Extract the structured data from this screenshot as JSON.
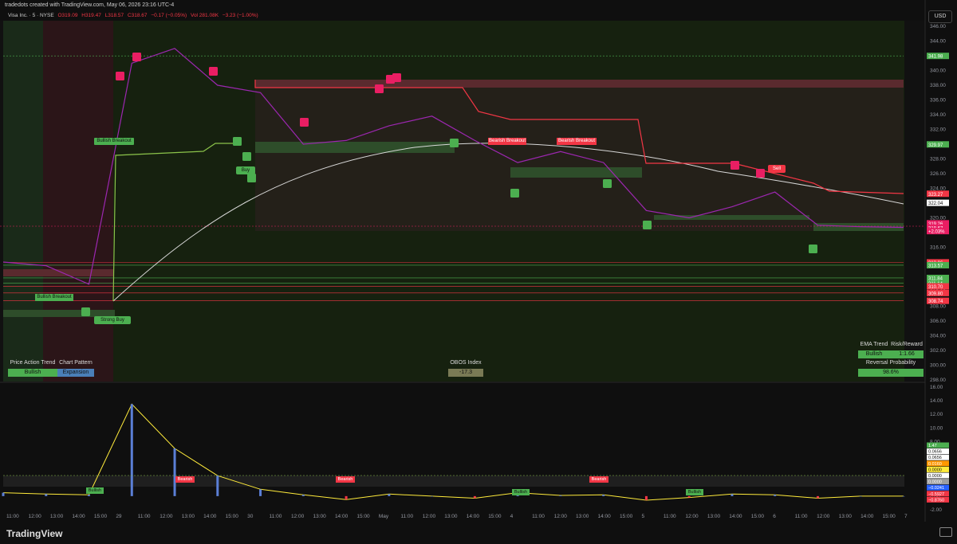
{
  "header": {
    "created_by": "tradedots created with TradingView.com, May 06, 2026 23:16 UTC-4",
    "symbol": "Visa Inc. · 5 · NYSE",
    "o": "O319.09",
    "h": "H319.47",
    "l": "L318.57",
    "c": "C318.67",
    "chg": "−0.17 (−0.05%)",
    "vol": "Vol 281.08K",
    "vol_chg": "−3.23 (−1.00%)",
    "currency": "USD"
  },
  "price_axis": [
    "346.00",
    "344.00",
    "342.00",
    "340.00",
    "338.00",
    "336.00",
    "334.00",
    "332.00",
    "330.00",
    "328.00",
    "326.00",
    "324.00",
    "322.00",
    "320.00",
    "318.00",
    "316.00",
    "314.00",
    "312.00",
    "310.00",
    "308.00",
    "306.00",
    "304.00",
    "302.00",
    "300.00",
    "298.00"
  ],
  "price_tags": [
    {
      "label": "341.98",
      "color": "#4caf50",
      "value": 341.98
    },
    {
      "label": "329.97",
      "color": "#4caf50",
      "value": 329.97
    },
    {
      "label": "323.27",
      "color": "#f23645",
      "value": 323.27
    },
    {
      "label": "322.04",
      "color": "#ffffff",
      "value": 322.04
    },
    {
      "label": "319.26",
      "color": "#e91e63",
      "value": 319.26
    },
    {
      "label": "318.67",
      "color": "#e91e63",
      "value": 318.67
    },
    {
      "label": "+2.03%",
      "color": "#e91e63",
      "value": 318.2
    },
    {
      "label": "313.96",
      "color": "#f23645",
      "value": 313.96
    },
    {
      "label": "313.57",
      "color": "#4caf50",
      "value": 313.57
    },
    {
      "label": "311.84",
      "color": "#4caf50",
      "value": 311.84
    },
    {
      "label": "311.14",
      "color": "#4caf50",
      "value": 311.14
    },
    {
      "label": "310.70",
      "color": "#f23645",
      "value": 310.7
    },
    {
      "label": "309.80",
      "color": "#f23645",
      "value": 309.8
    },
    {
      "label": "308.74",
      "color": "#f23645",
      "value": 308.74
    }
  ],
  "osc_axis": [
    "16.00",
    "14.00",
    "12.00",
    "10.00",
    "8.00",
    "6.00",
    "4.00",
    "2.00",
    "0.00",
    "-2.00"
  ],
  "osc_tags": [
    {
      "label": "1.47",
      "color": "#4caf50"
    },
    {
      "label": "0.0656",
      "color": "#ffffff"
    },
    {
      "label": "0.0656",
      "color": "#ffffff"
    },
    {
      "label": "0.0160",
      "color": "#ff9800"
    },
    {
      "label": "0.0000",
      "color": "#ffeb3b"
    },
    {
      "label": "0.0000",
      "color": "#ffffff"
    },
    {
      "label": "0.0000",
      "color": "#9e9e9e"
    },
    {
      "label": "−0.0241",
      "color": "#2962ff"
    },
    {
      "label": "−0.5927",
      "color": "#f23645"
    },
    {
      "label": "−0.8760",
      "color": "#f23645"
    }
  ],
  "time_axis": [
    "11:00",
    "12:00",
    "13:00",
    "14:00",
    "15:00",
    "29",
    "11:00",
    "12:00",
    "13:00",
    "14:00",
    "15:00",
    "30",
    "11:00",
    "12:00",
    "13:00",
    "14:00",
    "15:00",
    "May",
    "11:00",
    "12:00",
    "13:00",
    "14:00",
    "15:00",
    "4",
    "11:00",
    "12:00",
    "13:00",
    "14:00",
    "15:00",
    "5",
    "11:00",
    "12:00",
    "13:00",
    "14:00",
    "15:00",
    "6",
    "11:00",
    "12:00",
    "13:00",
    "14:00",
    "15:00",
    "7"
  ],
  "labels": {
    "bullish_breakout_1": "Bullish Breakout",
    "bullish_breakout_2": "Bullish Breakout",
    "bearish_breakout_1": "Bearish Breakout",
    "bearish_breakout_2": "Bearish Breakout",
    "buy": "Buy",
    "strong_buy": "Strong Buy",
    "sell": "Sell",
    "bearish_osc_1": "Bearish",
    "bearish_osc_2": "Bearish",
    "bearish_osc_3": "Bearish",
    "bullish_osc_1": "Bullish",
    "bullish_osc_2": "Bullish",
    "bullish_osc_3": "Bullish"
  },
  "panels": {
    "price_action_trend_title": "Price Action Trend",
    "price_action_trend_value": "Bullish",
    "chart_pattern_title": "Chart Pattern",
    "chart_pattern_value": "Expansion",
    "obos_title": "OBOS Index",
    "obos_value": "-17.3",
    "ema_trend_title": "EMA Trend",
    "ema_trend_value": "Bullish",
    "risk_reward_title": "Risk/Reward",
    "risk_reward_value": "1:1.66",
    "reversal_title": "Reversal Probability",
    "reversal_value": "98.6%"
  },
  "footer": {
    "brand": "TradingView"
  },
  "colors": {
    "bull": "#4caf50",
    "bear": "#f23645",
    "pink": "#e91e63",
    "ema": "#cfcfcf",
    "magenta": "#b21fd4",
    "teal": "#26a69a"
  },
  "chart_data": {
    "type": "line",
    "title": "",
    "x": [
      "Apr 28 11:00",
      "Apr 28 13:00",
      "Apr 28 15:00",
      "Apr 29 09:45",
      "Apr 29 10:30",
      "Apr 29 12:00",
      "Apr 29 15:00",
      "Apr 30 10:00",
      "Apr 30 13:00",
      "May 1 11:00",
      "May 1 14:00",
      "May 1 15:30",
      "May 4 10:00",
      "May 4 13:00",
      "May 4 15:30",
      "May 5 10:00",
      "May 5 13:00",
      "May 5 15:30",
      "May 6 10:00",
      "May 6 11:00",
      "May 6 13:00",
      "May 6 15:30"
    ],
    "series": [
      {
        "values": [
          314.0,
          313.5,
          311.0,
          341.0,
          343.0,
          338.0,
          337.0,
          330.0,
          330.5,
          332.5,
          333.8,
          330.5,
          327.5,
          329.0,
          327.5,
          321.0,
          320.0,
          321.5,
          323.5,
          319.0,
          318.8,
          318.7
        ]
      }
    ],
    "ylim": [
      298,
      346
    ],
    "oscillator": {
      "ylim": [
        -2,
        16
      ],
      "values": [
        0.5,
        0.3,
        0.2,
        13.5,
        7.0,
        3.0,
        1.0,
        0.2,
        -0.5,
        0.3,
        0.0,
        -0.3,
        0.5,
        0.1,
        0.2,
        -0.6,
        -0.2,
        0.3,
        0.2,
        -0.3,
        0.0,
        0.0
      ]
    }
  }
}
